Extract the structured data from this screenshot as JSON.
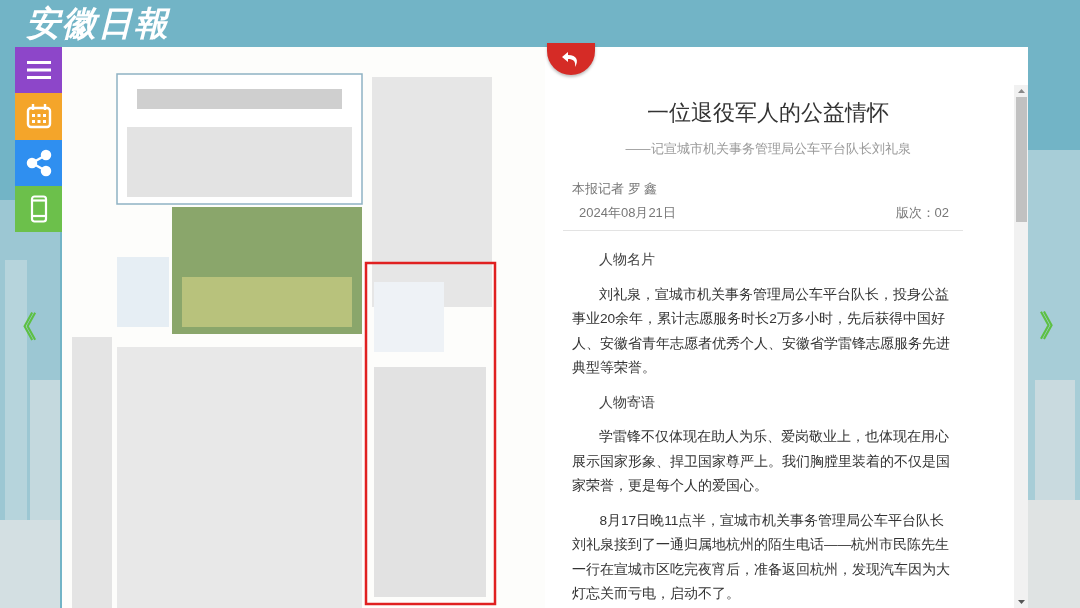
{
  "logo": "安徽日報",
  "side_menu": [
    {
      "kind": "menu",
      "color": "#8d46c9"
    },
    {
      "kind": "calendar",
      "color": "#f4a52a"
    },
    {
      "kind": "share",
      "color": "#2f8ff0"
    },
    {
      "kind": "mobile",
      "color": "#6cc04b"
    }
  ],
  "nav": {
    "previous": "《",
    "next": "》"
  },
  "article": {
    "title": "一位退役军人的公益情怀",
    "subtitle": "——记宣城市机关事务管理局公车平台队长刘礼泉",
    "byline": "本报记者 罗 鑫",
    "date": "2024年08月21日",
    "edition": "版次：02",
    "paragraphs": [
      {
        "kind": "heading",
        "text": "人物名片"
      },
      {
        "kind": "body",
        "text": "刘礼泉，宣城市机关事务管理局公车平台队长，投身公益事业20余年，累计志愿服务时长2万多小时，先后获得中国好人、安徽省青年志愿者优秀个人、安徽省学雷锋志愿服务先进典型等荣誉。"
      },
      {
        "kind": "heading",
        "text": "人物寄语"
      },
      {
        "kind": "body",
        "text": "学雷锋不仅体现在助人为乐、爱岗敬业上，也体现在用心展示国家形象、捍卫国家尊严上。我们胸膛里装着的不仅是国家荣誉，更是每个人的爱国心。"
      },
      {
        "kind": "body",
        "text": "8月17日晚11点半，宣城市机关事务管理局公车平台队长刘礼泉接到了一通归属地杭州的陌生电话——杭州市民陈先生一行在宣城市区吃完夜宵后，准备返回杭州，发现汽车因为大灯忘关而亏电，启动不了。"
      }
    ]
  }
}
